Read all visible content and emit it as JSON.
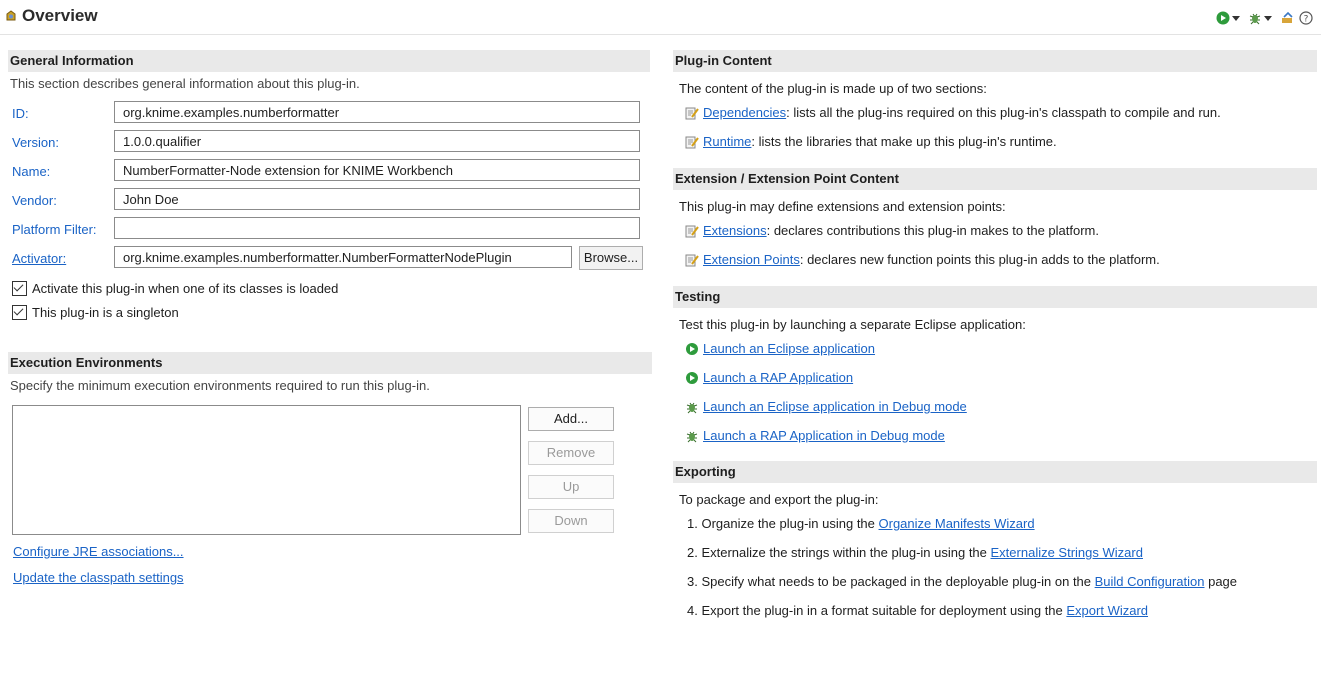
{
  "header": {
    "title": "Overview",
    "icons": [
      "plugin-icon",
      "run-icon",
      "debug-icon",
      "export-icon",
      "help-icon"
    ]
  },
  "general": {
    "heading": "General Information",
    "description": "This section describes general information about this plug-in.",
    "id_label": "ID:",
    "id_value": "org.knime.examples.numberformatter",
    "version_label": "Version:",
    "version_value": "1.0.0.qualifier",
    "name_label": "Name:",
    "name_value": "NumberFormatter-Node extension for KNIME Workbench",
    "vendor_label": "Vendor:",
    "vendor_value": "John Doe",
    "platform_label": "Platform Filter:",
    "platform_value": "",
    "activator_label": "Activator:",
    "activator_value": "org.knime.examples.numberformatter.NumberFormatterNodePlugin",
    "browse_label": "Browse...",
    "activate_label": "Activate this plug-in when one of its classes is loaded",
    "singleton_label": "This plug-in is a singleton"
  },
  "exec": {
    "heading": "Execution Environments",
    "description": "Specify the minimum execution environments required to run this plug-in.",
    "add_label": "Add...",
    "remove_label": "Remove",
    "up_label": "Up",
    "down_label": "Down",
    "configure_link": "Configure JRE associations...",
    "update_link": "Update the classpath settings"
  },
  "content": {
    "heading": "Plug-in Content",
    "intro": "The content of the plug-in is made up of two sections:",
    "deps_link": "Dependencies",
    "deps_text": ": lists all the plug-ins required on this plug-in's classpath to compile and run.",
    "runtime_link": "Runtime",
    "runtime_text": ": lists the libraries that make up this plug-in's runtime."
  },
  "extension": {
    "heading": "Extension / Extension Point Content",
    "intro": "This plug-in may define extensions and extension points:",
    "ext_link": "Extensions",
    "ext_text": ": declares contributions this plug-in makes to the platform.",
    "extpt_link": "Extension Points",
    "extpt_text": ": declares new function points this plug-in adds to the platform."
  },
  "testing": {
    "heading": "Testing",
    "intro": "Test this plug-in by launching a separate Eclipse application:",
    "launch_eclipse": "Launch an Eclipse application",
    "launch_rap": "Launch a RAP Application",
    "debug_eclipse": "Launch an Eclipse application in Debug mode",
    "debug_rap": "Launch a RAP Application in Debug mode"
  },
  "exporting": {
    "heading": "Exporting",
    "intro": "To package and export the plug-in:",
    "step1_text": "1.  Organize the plug-in using the ",
    "step1_link": "Organize Manifests Wizard",
    "step2_text": "2.  Externalize the strings within the plug-in using the ",
    "step2_link": "Externalize Strings Wizard",
    "step3_text": "3.  Specify what needs to be packaged in the deployable plug-in on the ",
    "step3_link": "Build Configuration",
    "step3_suffix": " page",
    "step4_text": "4.  Export the plug-in in a format suitable for deployment using the ",
    "step4_link": "Export Wizard"
  },
  "colors": {
    "link": "#1a63c6",
    "section_header_bg": "#e9e9e9",
    "run_green": "#2e9b3c"
  }
}
